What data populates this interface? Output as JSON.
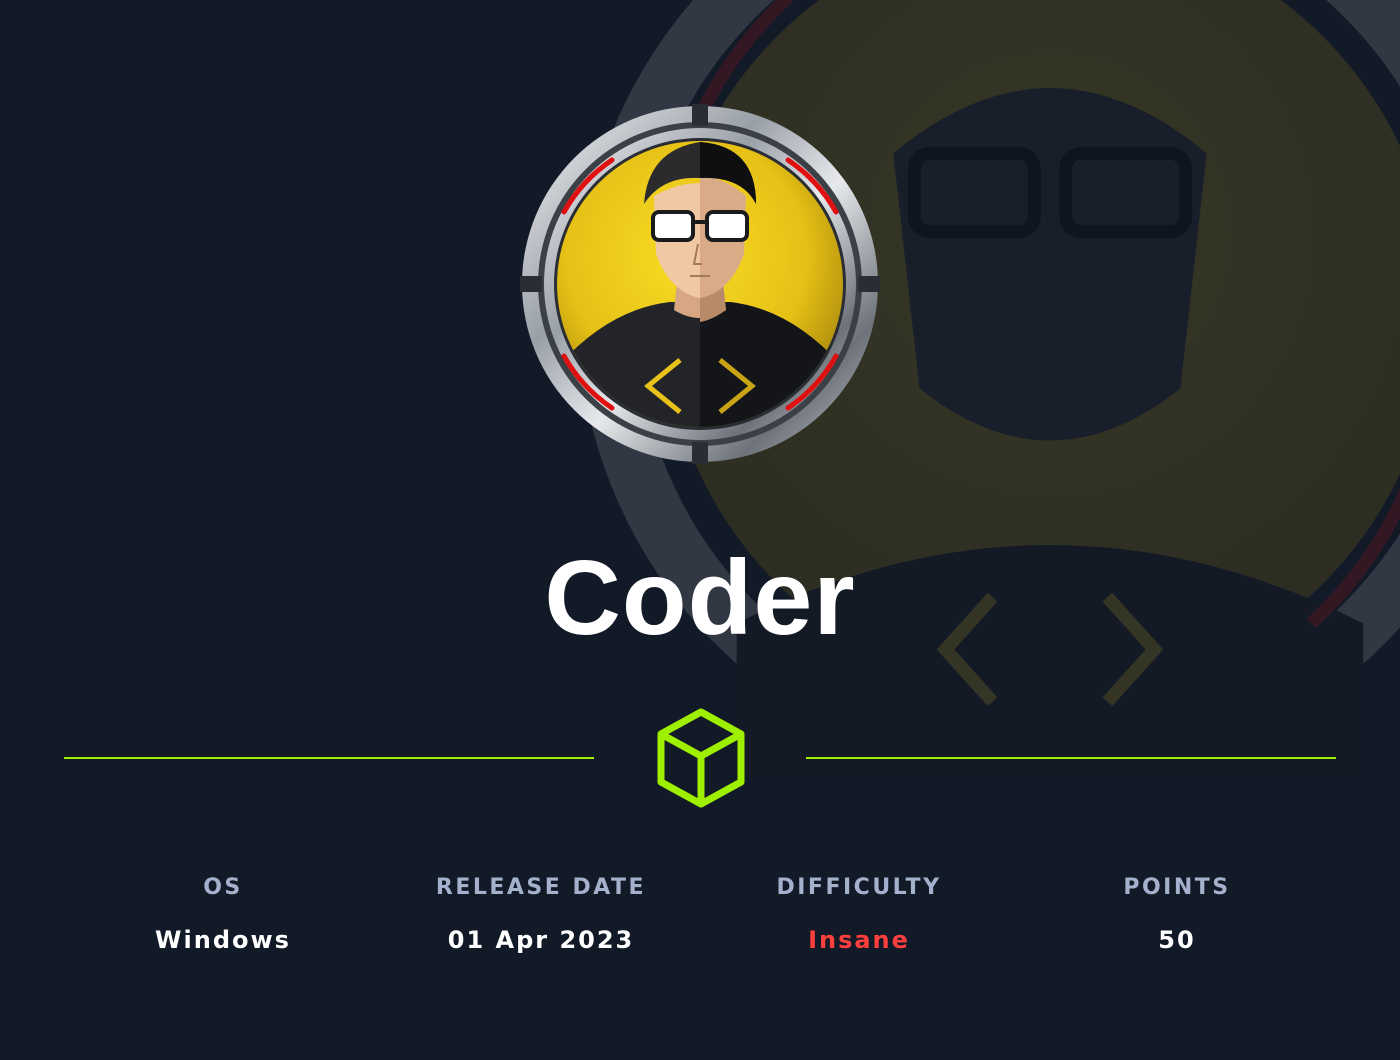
{
  "machine": {
    "name": "Coder"
  },
  "stats": [
    {
      "label": "OS",
      "value": "Windows"
    },
    {
      "label": "RELEASE DATE",
      "value": "01 Apr 2023"
    },
    {
      "label": "DIFFICULTY",
      "value": "Insane"
    },
    {
      "label": "POINTS",
      "value": "50"
    }
  ],
  "icons": {
    "avatar": "machine-avatar-icon",
    "divider": "box-icon"
  },
  "colors": {
    "background": "#121a27",
    "accent": "#9fef00",
    "label": "#a4b1cd",
    "value": "#ffffff",
    "difficulty": "#ff3e3e",
    "avatar_bg": "#e8c51a",
    "ring_red": "#e01010"
  }
}
